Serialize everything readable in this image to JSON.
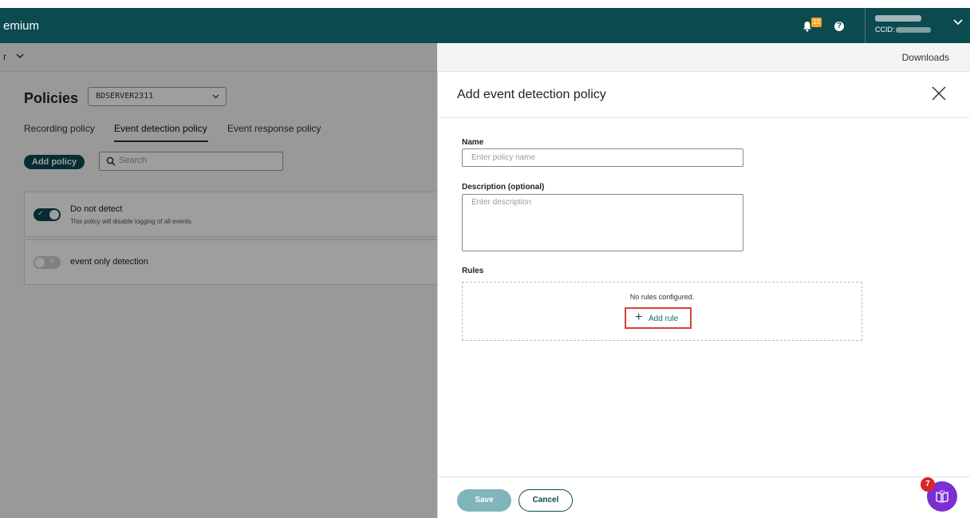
{
  "app": {
    "brand": "emium"
  },
  "topbar": {
    "notif_count": "12",
    "help_glyph": "?",
    "ccid_label": "CCID:"
  },
  "subbar": {
    "left_label": "r",
    "downloads": "Downloads"
  },
  "policies": {
    "title": "Policies",
    "server": "BDSERVER2311",
    "tabs": [
      {
        "label": "Recording policy"
      },
      {
        "label": "Event detection policy"
      },
      {
        "label": "Event response policy"
      }
    ],
    "active_tab": "Event detection policy",
    "add_button": "Add policy",
    "search_placeholder": "Search",
    "items": [
      {
        "title": "Do not detect",
        "description": "This policy will disable logging of all events.",
        "enabled": true
      },
      {
        "title": "event only detection",
        "description": "",
        "enabled": false
      }
    ]
  },
  "panel": {
    "title": "Add event detection policy",
    "name_label": "Name",
    "name_placeholder": "Enter policy name",
    "description_label": "Description (optional)",
    "description_placeholder": "Enter description",
    "rules_label": "Rules",
    "no_rules_text": "No rules configured.",
    "add_rule_label": "Add rule",
    "save_label": "Save",
    "cancel_label": "Cancel"
  },
  "assistant": {
    "badge_count": "7"
  },
  "colors": {
    "brand": "#0b4a4f",
    "accent_highlight": "#d9403a",
    "assistant": "#7a2fd3"
  }
}
